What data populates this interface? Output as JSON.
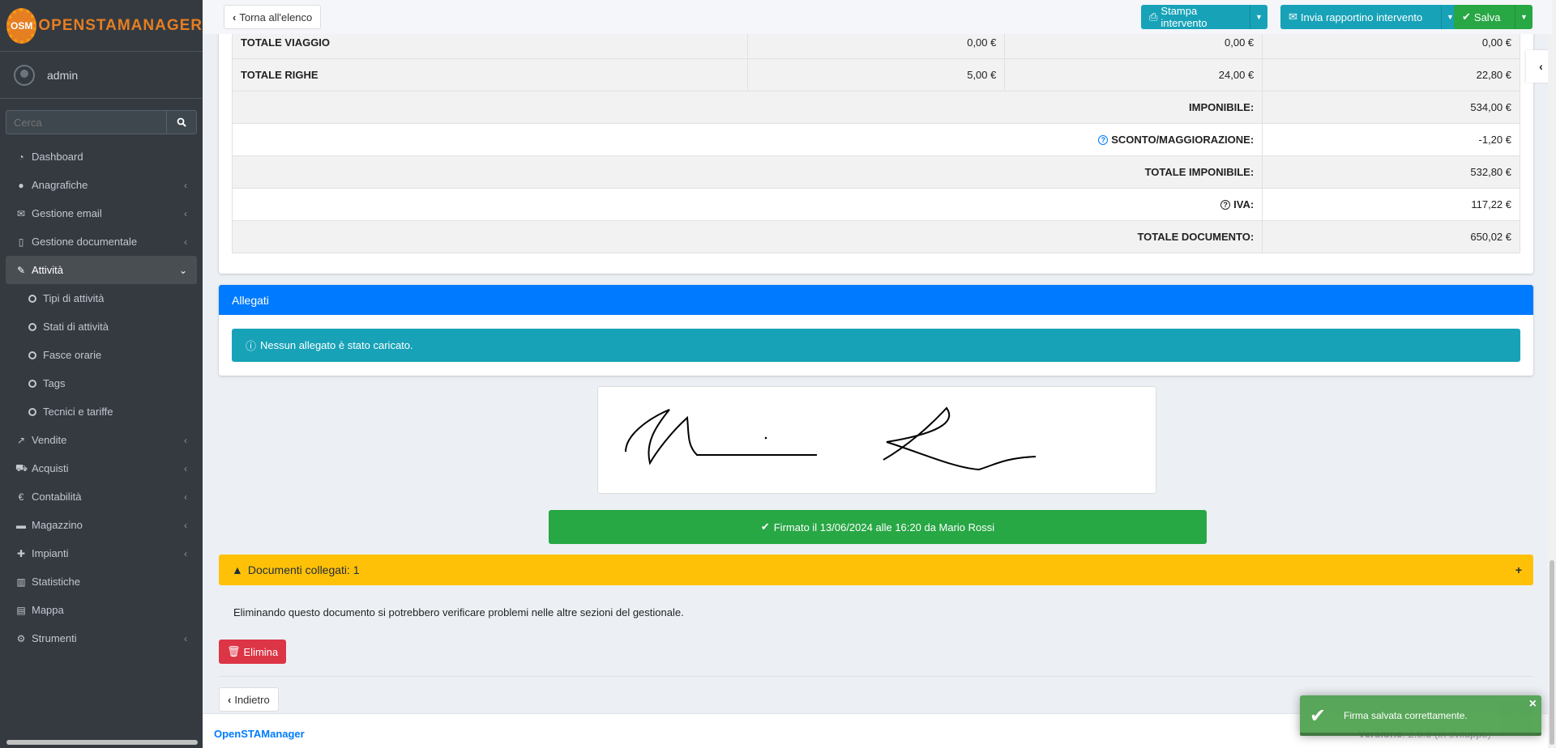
{
  "app": {
    "brand_logo": "OSM",
    "brand_name": "OPENSTAMANAGER",
    "user": "admin"
  },
  "search": {
    "placeholder": "Cerca"
  },
  "sidebar": {
    "items": [
      {
        "label": "Dashboard",
        "icon": "dashboard-icon"
      },
      {
        "label": "Anagrafiche",
        "icon": "users-icon"
      },
      {
        "label": "Gestione email",
        "icon": "envelope-icon"
      },
      {
        "label": "Gestione documentale",
        "icon": "file-icon"
      },
      {
        "label": "Attività",
        "icon": "wrench-icon"
      },
      {
        "label": "Tipi di attività",
        "icon": "circle-icon"
      },
      {
        "label": "Stati di attività",
        "icon": "circle-icon"
      },
      {
        "label": "Fasce orarie",
        "icon": "circle-icon"
      },
      {
        "label": "Tags",
        "icon": "circle-icon"
      },
      {
        "label": "Tecnici e tariffe",
        "icon": "circle-icon"
      },
      {
        "label": "Vendite",
        "icon": "chart-line-icon"
      },
      {
        "label": "Acquisti",
        "icon": "cart-icon"
      },
      {
        "label": "Contabilità",
        "icon": "euro-icon"
      },
      {
        "label": "Magazzino",
        "icon": "truck-icon"
      },
      {
        "label": "Impianti",
        "icon": "puzzle-icon"
      },
      {
        "label": "Statistiche",
        "icon": "bar-chart-icon"
      },
      {
        "label": "Mappa",
        "icon": "map-icon"
      },
      {
        "label": "Strumenti",
        "icon": "cog-icon"
      }
    ]
  },
  "toolbar": {
    "back_label": "Torna all'elenco",
    "print_label": "Stampa intervento",
    "send_label": "Invia rapportino intervento",
    "save_label": "Salva"
  },
  "totals": {
    "viaggio": {
      "label": "TOTALE VIAGGIO",
      "c1": "0,00 €",
      "c2": "0,00 €",
      "c3": "0,00 €"
    },
    "righe": {
      "label": "TOTALE RIGHE",
      "c1": "5,00 €",
      "c2": "24,00 €",
      "c3": "22,80 €"
    },
    "imponibile": {
      "label": "IMPONIBILE:",
      "value": "534,00 €"
    },
    "sconto": {
      "label": "SCONTO/MAGGIORAZIONE:",
      "value": "-1,20 €"
    },
    "totale_imponibile": {
      "label": "TOTALE IMPONIBILE:",
      "value": "532,80 €"
    },
    "iva": {
      "label": "IVA:",
      "value": "117,22 €"
    },
    "totale_documento": {
      "label": "TOTALE DOCUMENTO:",
      "value": "650,02 €"
    }
  },
  "allegati": {
    "title": "Allegati",
    "empty_message": "Nessun allegato è stato caricato."
  },
  "signature": {
    "signed_text": "Firmato il 13/06/2024 alle 16:20 da Mario Rossi"
  },
  "linked_docs": {
    "label": "Documenti collegati: 1",
    "warning": "Eliminando questo documento si potrebbero verificare problemi nelle altre sezioni del gestionale."
  },
  "actions": {
    "delete_label": "Elimina",
    "back_label": "Indietro"
  },
  "footer": {
    "brand": "OpenSTAManager",
    "version_label": "Versione",
    "version": "2.5.3 (in sviluppo)"
  },
  "toast": {
    "message": "Firma salvata correttamente.",
    "close": "×"
  },
  "colors": {
    "sidebar_bg": "#343a40",
    "primary": "#007bff",
    "info": "#17a2b8",
    "success": "#28a745",
    "warning": "#ffc107",
    "danger": "#dc3545",
    "brand": "#e67e22"
  }
}
